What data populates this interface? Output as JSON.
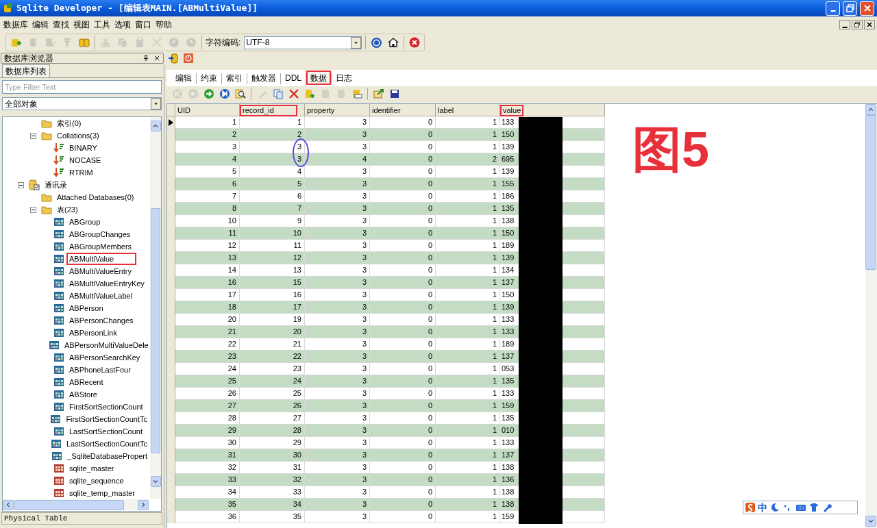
{
  "window": {
    "title": "Sqlite Developer - [编辑表MAIN.[ABMultiValue]]"
  },
  "menu": [
    "数据库",
    "编辑",
    "查找",
    "视图",
    "工具",
    "选项",
    "窗口",
    "帮助"
  ],
  "toolbar": {
    "buttons_disabled": [
      false,
      true,
      true,
      true,
      false,
      true,
      true,
      true,
      true,
      true,
      true
    ],
    "encoding_label": "字符编码:",
    "encoding_value": "UTF-8"
  },
  "browser": {
    "title": "数据库浏览器",
    "tab": "数据库列表",
    "filter_placeholder": "Type Filter Text",
    "object_filter": "全部对象",
    "status": "Physical Table",
    "tree": [
      {
        "kind": "scrolled",
        "children": [
          {
            "label": "索引(0)",
            "kind": "folder",
            "annotated": false
          },
          {
            "label": "Collations(3)",
            "kind": "folder",
            "expanded": true,
            "annotated": false,
            "children": [
              {
                "label": "BINARY",
                "kind": "collation",
                "annotated": false
              },
              {
                "label": "NOCASE",
                "kind": "collation",
                "annotated": false
              },
              {
                "label": "RTRIM",
                "kind": "collation",
                "annotated": false
              }
            ]
          }
        ]
      },
      {
        "label": "通讯录",
        "kind": "database",
        "expanded": true,
        "annotated": false,
        "children": [
          {
            "label": "Attached Databases(0)",
            "kind": "folder",
            "annotated": false
          },
          {
            "label": "表(23)",
            "kind": "folder",
            "expanded": true,
            "annotated": false,
            "children": [
              {
                "label": "ABGroup",
                "kind": "table",
                "annotated": false
              },
              {
                "label": "ABGroupChanges",
                "kind": "table",
                "annotated": false
              },
              {
                "label": "ABGroupMembers",
                "kind": "table",
                "annotated": false
              },
              {
                "label": "ABMultiValue",
                "kind": "table",
                "annotated": true
              },
              {
                "label": "ABMultiValueEntry",
                "kind": "table",
                "annotated": false
              },
              {
                "label": "ABMultiValueEntryKey",
                "kind": "table",
                "annotated": false
              },
              {
                "label": "ABMultiValueLabel",
                "kind": "table",
                "annotated": false
              },
              {
                "label": "ABPerson",
                "kind": "table",
                "annotated": false
              },
              {
                "label": "ABPersonChanges",
                "kind": "table",
                "annotated": false
              },
              {
                "label": "ABPersonLink",
                "kind": "table",
                "annotated": false
              },
              {
                "label": "ABPersonMultiValueDele",
                "kind": "table",
                "annotated": false
              },
              {
                "label": "ABPersonSearchKey",
                "kind": "table",
                "annotated": false
              },
              {
                "label": "ABPhoneLastFour",
                "kind": "table",
                "annotated": false
              },
              {
                "label": "ABRecent",
                "kind": "table",
                "annotated": false
              },
              {
                "label": "ABStore",
                "kind": "table",
                "annotated": false
              },
              {
                "label": "FirstSortSectionCount",
                "kind": "table",
                "annotated": false
              },
              {
                "label": "FirstSortSectionCountTc",
                "kind": "table",
                "annotated": false
              },
              {
                "label": "LastSortSectionCount",
                "kind": "table",
                "annotated": false
              },
              {
                "label": "LastSortSectionCountTc",
                "kind": "table",
                "annotated": false
              },
              {
                "label": "_SqliteDatabasePropert",
                "kind": "table",
                "annotated": false
              },
              {
                "label": "sqlite_master",
                "kind": "system-table",
                "annotated": false
              },
              {
                "label": "sqlite_sequence",
                "kind": "system-table",
                "annotated": false
              },
              {
                "label": "sqlite_temp_master",
                "kind": "system-table",
                "annotated": false
              }
            ]
          }
        ]
      }
    ]
  },
  "tabs": [
    {
      "label": "编辑",
      "selected": false,
      "annotated": false
    },
    {
      "label": "约束",
      "selected": false,
      "annotated": false
    },
    {
      "label": "索引",
      "selected": false,
      "annotated": false
    },
    {
      "label": "触发器",
      "selected": false,
      "annotated": false
    },
    {
      "label": "DDL",
      "selected": false,
      "annotated": false
    },
    {
      "label": "数据",
      "selected": true,
      "annotated": true
    },
    {
      "label": "日志",
      "selected": false,
      "annotated": false
    }
  ],
  "data_toolbar": {
    "buttons_disabled": [
      true,
      true,
      false,
      false,
      false,
      true,
      false,
      false,
      false,
      true,
      true,
      false,
      false,
      false
    ]
  },
  "table": {
    "columns": [
      {
        "label": "UID",
        "annotated": false
      },
      {
        "label": "record_id",
        "annotated": true
      },
      {
        "label": "property",
        "annotated": false
      },
      {
        "label": "identifier",
        "annotated": false
      },
      {
        "label": "label",
        "annotated": false
      },
      {
        "label": "value",
        "annotated": true
      }
    ],
    "rows": [
      {
        "cells": [
          "1",
          "1",
          "3",
          "0",
          "1",
          "133"
        ],
        "current": true,
        "circled": false
      },
      {
        "cells": [
          "2",
          "2",
          "3",
          "0",
          "1",
          "150"
        ],
        "current": false,
        "circled": false
      },
      {
        "cells": [
          "3",
          "3",
          "3",
          "0",
          "1",
          "139"
        ],
        "current": false,
        "circled": true
      },
      {
        "cells": [
          "4",
          "3",
          "4",
          "0",
          "2",
          "695"
        ],
        "current": false,
        "circled": true
      },
      {
        "cells": [
          "5",
          "4",
          "3",
          "0",
          "1",
          "139"
        ],
        "current": false,
        "circled": false
      },
      {
        "cells": [
          "6",
          "5",
          "3",
          "0",
          "1",
          "155"
        ],
        "current": false,
        "circled": false
      },
      {
        "cells": [
          "7",
          "6",
          "3",
          "0",
          "1",
          "186"
        ],
        "current": false,
        "circled": false
      },
      {
        "cells": [
          "8",
          "7",
          "3",
          "0",
          "1",
          "135"
        ],
        "current": false,
        "circled": false
      },
      {
        "cells": [
          "10",
          "9",
          "3",
          "0",
          "1",
          "138"
        ],
        "current": false,
        "circled": false
      },
      {
        "cells": [
          "11",
          "10",
          "3",
          "0",
          "1",
          "150"
        ],
        "current": false,
        "circled": false
      },
      {
        "cells": [
          "12",
          "11",
          "3",
          "0",
          "1",
          "189"
        ],
        "current": false,
        "circled": false
      },
      {
        "cells": [
          "13",
          "12",
          "3",
          "0",
          "1",
          "139"
        ],
        "current": false,
        "circled": false
      },
      {
        "cells": [
          "14",
          "13",
          "3",
          "0",
          "1",
          "134"
        ],
        "current": false,
        "circled": false
      },
      {
        "cells": [
          "16",
          "15",
          "3",
          "0",
          "1",
          "137"
        ],
        "current": false,
        "circled": false
      },
      {
        "cells": [
          "17",
          "16",
          "3",
          "0",
          "1",
          "150"
        ],
        "current": false,
        "circled": false
      },
      {
        "cells": [
          "18",
          "17",
          "3",
          "0",
          "1",
          "139"
        ],
        "current": false,
        "circled": false
      },
      {
        "cells": [
          "20",
          "19",
          "3",
          "0",
          "1",
          "133"
        ],
        "current": false,
        "circled": false
      },
      {
        "cells": [
          "21",
          "20",
          "3",
          "0",
          "1",
          "133"
        ],
        "current": false,
        "circled": false
      },
      {
        "cells": [
          "22",
          "21",
          "3",
          "0",
          "1",
          "189"
        ],
        "current": false,
        "circled": false
      },
      {
        "cells": [
          "23",
          "22",
          "3",
          "0",
          "1",
          "137"
        ],
        "current": false,
        "circled": false
      },
      {
        "cells": [
          "24",
          "23",
          "3",
          "0",
          "1",
          "053"
        ],
        "current": false,
        "circled": false
      },
      {
        "cells": [
          "25",
          "24",
          "3",
          "0",
          "1",
          "135"
        ],
        "current": false,
        "circled": false
      },
      {
        "cells": [
          "26",
          "25",
          "3",
          "0",
          "1",
          "133"
        ],
        "current": false,
        "circled": false
      },
      {
        "cells": [
          "27",
          "26",
          "3",
          "0",
          "1",
          "159"
        ],
        "current": false,
        "circled": false
      },
      {
        "cells": [
          "28",
          "27",
          "3",
          "0",
          "1",
          "135"
        ],
        "current": false,
        "circled": false
      },
      {
        "cells": [
          "29",
          "28",
          "3",
          "0",
          "1",
          "010"
        ],
        "current": false,
        "circled": false
      },
      {
        "cells": [
          "30",
          "29",
          "3",
          "0",
          "1",
          "133"
        ],
        "current": false,
        "circled": false
      },
      {
        "cells": [
          "31",
          "30",
          "3",
          "0",
          "1",
          "137"
        ],
        "current": false,
        "circled": false
      },
      {
        "cells": [
          "32",
          "31",
          "3",
          "0",
          "1",
          "138"
        ],
        "current": false,
        "circled": false
      },
      {
        "cells": [
          "33",
          "32",
          "3",
          "0",
          "1",
          "136"
        ],
        "current": false,
        "circled": false
      },
      {
        "cells": [
          "34",
          "33",
          "3",
          "0",
          "1",
          "138"
        ],
        "current": false,
        "circled": false
      },
      {
        "cells": [
          "35",
          "34",
          "3",
          "0",
          "1",
          "138"
        ],
        "current": false,
        "circled": false
      },
      {
        "cells": [
          "36",
          "35",
          "3",
          "0",
          "1",
          "159"
        ],
        "current": false,
        "circled": false
      }
    ]
  },
  "figure_label": "图5",
  "ime_bar": {
    "mode": "中"
  }
}
